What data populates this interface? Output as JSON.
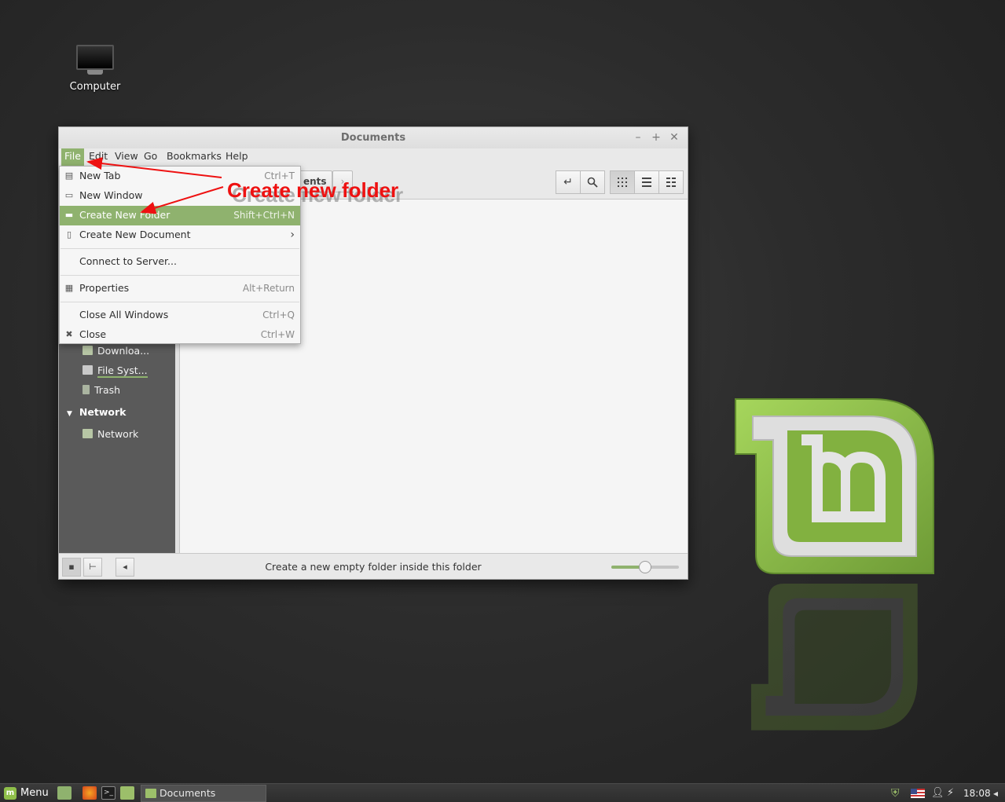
{
  "desktop": {
    "icons": [
      {
        "label": "Computer",
        "icon": "computer-icon"
      }
    ]
  },
  "window": {
    "title": "Documents",
    "controls": {
      "minimize": "–",
      "maximize": "+",
      "close": "✕"
    },
    "menubar": [
      "File",
      "Edit",
      "View",
      "Go",
      "Bookmarks",
      "Help"
    ],
    "path_buttons": {
      "current": "Documents",
      "current_visible": "ents",
      "forward": "›"
    },
    "toolbar_icons": [
      "toggle-location-icon",
      "search-icon",
      "icon-view-icon",
      "list-view-icon",
      "compact-view-icon"
    ],
    "sidebar": {
      "items": [
        {
          "label": "Downloa...",
          "icon": "downloads-icon"
        },
        {
          "label": "File Syst...",
          "icon": "filesystem-icon"
        },
        {
          "label": "Trash",
          "icon": "trash-icon"
        }
      ],
      "network_header": "Network",
      "network_items": [
        {
          "label": "Network",
          "icon": "network-icon"
        }
      ]
    },
    "status_text": "Create a new empty folder inside this folder",
    "zoom_level": 0.5
  },
  "file_menu": {
    "items": [
      {
        "label": "New Tab",
        "accel": "Ctrl+T",
        "icon": "new-tab-icon"
      },
      {
        "label": "New Window",
        "accel": "",
        "icon": "new-window-icon"
      },
      {
        "label": "Create New Folder",
        "accel": "Shift+Ctrl+N",
        "icon": "new-folder-icon",
        "highlighted": true
      },
      {
        "label": "Create New Document",
        "accel": "›",
        "icon": "new-document-icon"
      },
      {
        "label": "Connect to Server...",
        "accel": ""
      },
      {
        "label": "Properties",
        "accel": "Alt+Return",
        "icon": "properties-icon"
      },
      {
        "label": "Close All Windows",
        "accel": "Ctrl+Q"
      },
      {
        "label": "Close",
        "accel": "Ctrl+W",
        "icon": "close-icon"
      }
    ]
  },
  "annotation": {
    "text": "Create new folder",
    "color": "#ee1111"
  },
  "taskbar": {
    "menu_label": "Menu",
    "task_label": "Documents",
    "clock": "18:08"
  },
  "colors": {
    "accent": "#8fb26e",
    "sidebar_bg": "#5a5a5a"
  }
}
